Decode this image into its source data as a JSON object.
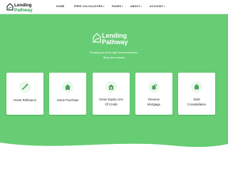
{
  "brand": {
    "line1": "Lending",
    "line2": "Pathway"
  },
  "nav": {
    "items": [
      {
        "label": "HOME",
        "dropdown": false
      },
      {
        "label": "FREE CALCULATORS",
        "dropdown": true
      },
      {
        "label": "PAGES",
        "dropdown": true
      },
      {
        "label": "ABOUT",
        "dropdown": true
      },
      {
        "label": "ACCOUNT",
        "dropdown": true
      }
    ],
    "caret": "▾"
  },
  "hero": {
    "tagline_line1": "Reading you at the right financial decision.",
    "tagline_line2": "Shop and compare",
    "background": "#66cd74"
  },
  "cards": [
    {
      "label_line1": "Home Refinance",
      "label_line2": "",
      "icon": "pencil-icon"
    },
    {
      "label_line1": "Home Purchase",
      "label_line2": "",
      "icon": "house-icon"
    },
    {
      "label_line1": "Home Equity Line",
      "label_line2": "Of Credit",
      "icon": "home-equity-icon"
    },
    {
      "label_line1": "Reverse",
      "label_line2": "Mortgage",
      "icon": "reverse-mortgage-icon"
    },
    {
      "label_line1": "Debt",
      "label_line2": "Consolidation",
      "icon": "debt-consolidation-icon"
    }
  ],
  "colors": {
    "accent": "#66cd74",
    "brand_green": "#2e9f4e"
  }
}
